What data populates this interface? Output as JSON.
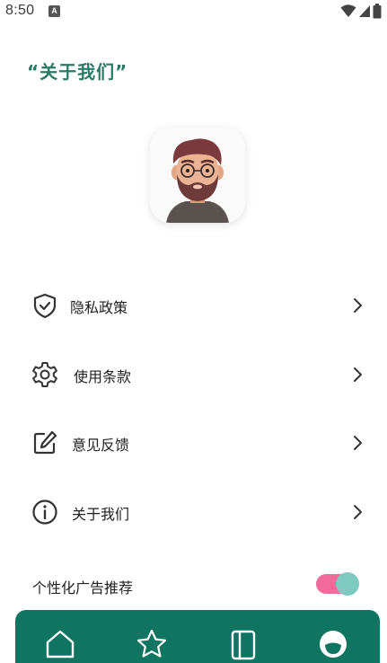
{
  "status_bar": {
    "time": "8:50",
    "notification_badge": "A",
    "icons": [
      "wifi-icon",
      "signal-icon",
      "battery-icon"
    ]
  },
  "page": {
    "title": "“关于我们”"
  },
  "avatar": {
    "icon": "bearded-man-avatar"
  },
  "menu": [
    {
      "label": "隐私政策",
      "icon": "shield-check-icon"
    },
    {
      "label": "使用条款",
      "icon": "gear-icon"
    },
    {
      "label": "意见反馈",
      "icon": "edit-icon"
    },
    {
      "label": "关于我们",
      "icon": "info-icon"
    }
  ],
  "personalized_ads": {
    "label": "个性化广告推荐",
    "enabled": true
  },
  "bottom_nav": {
    "items": [
      {
        "icon": "home-icon"
      },
      {
        "icon": "star-icon"
      },
      {
        "icon": "book-icon"
      },
      {
        "icon": "profile-icon",
        "active": true
      }
    ]
  },
  "colors": {
    "accent": "#2a7a67",
    "nav_bg": "#0f7560",
    "toggle_track": "#f06b9a",
    "toggle_thumb": "#7ecac0"
  }
}
